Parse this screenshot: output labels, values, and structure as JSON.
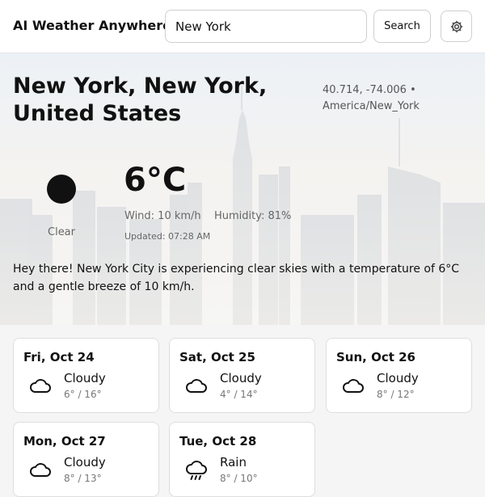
{
  "app": {
    "title": "AI Weather Anywhere"
  },
  "search": {
    "value": "New York",
    "button_label": "Search",
    "settings_icon": "gear-icon"
  },
  "current": {
    "location": "New York, New York, United States",
    "coords": "40.714, -74.006 •",
    "timezone": "America/New_York",
    "condition": "Clear",
    "condition_icon": "clear-sky-icon",
    "temperature": "6°C",
    "wind": "Wind: 10 km/h",
    "humidity": "Humidity: 81%",
    "updated": "Updated: 07:28 AM",
    "summary": "Hey there! New York City is experiencing clear skies with a temperature of 6°C and a gentle breeze of 10 km/h."
  },
  "forecast": [
    {
      "day": "Fri, Oct 24",
      "condition": "Cloudy",
      "range": "6° / 16°",
      "icon": "cloud-icon"
    },
    {
      "day": "Sat, Oct 25",
      "condition": "Cloudy",
      "range": "4° / 14°",
      "icon": "cloud-icon"
    },
    {
      "day": "Sun, Oct 26",
      "condition": "Cloudy",
      "range": "8° / 12°",
      "icon": "cloud-icon"
    },
    {
      "day": "Mon, Oct 27",
      "condition": "Cloudy",
      "range": "8° / 13°",
      "icon": "cloud-icon"
    },
    {
      "day": "Tue, Oct 28",
      "condition": "Rain",
      "range": "8° / 10°",
      "icon": "rain-icon"
    }
  ]
}
